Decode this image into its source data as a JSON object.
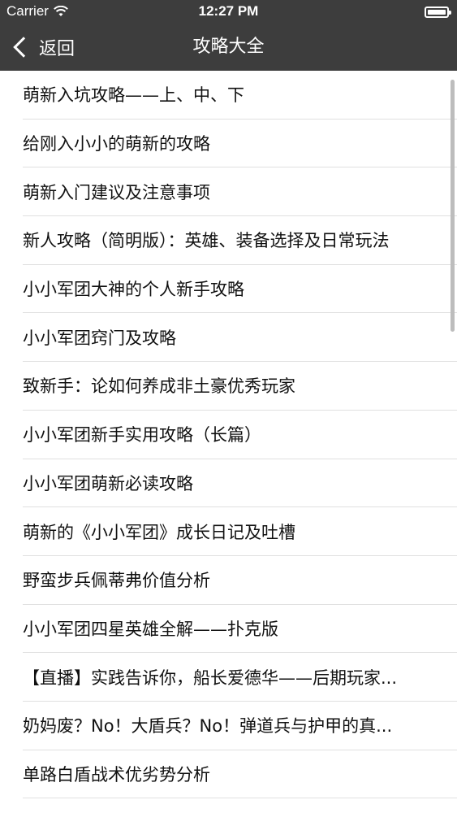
{
  "status_bar": {
    "carrier": "Carrier",
    "time": "12:27 PM"
  },
  "nav": {
    "back_label": "返回",
    "title": "攻略大全"
  },
  "list": {
    "items": [
      "萌新入坑攻略——上、中、下",
      "给刚入小小的萌新的攻略",
      "萌新入门建议及注意事项",
      "新人攻略（简明版）：英雄、装备选择及日常玩法",
      "小小军团大神的个人新手攻略",
      "小小军团窍门及攻略",
      "致新手：论如何养成非土豪优秀玩家",
      "小小军团新手实用攻略（长篇）",
      "小小军团萌新必读攻略",
      "萌新的《小小军团》成长日记及吐槽",
      "野蛮步兵佩蒂弗价值分析",
      "小小军团四星英雄全解——扑克版",
      "【直播】实践告诉你，船长爱德华——后期玩家...",
      "奶妈废？No！大盾兵？No！弹道兵与护甲的真...",
      "单路白盾战术优劣势分析"
    ]
  },
  "colors": {
    "nav_background": "#3d3d3d",
    "nav_text": "#ffffff",
    "list_background": "#ffffff",
    "separator": "#e0e0e0"
  }
}
